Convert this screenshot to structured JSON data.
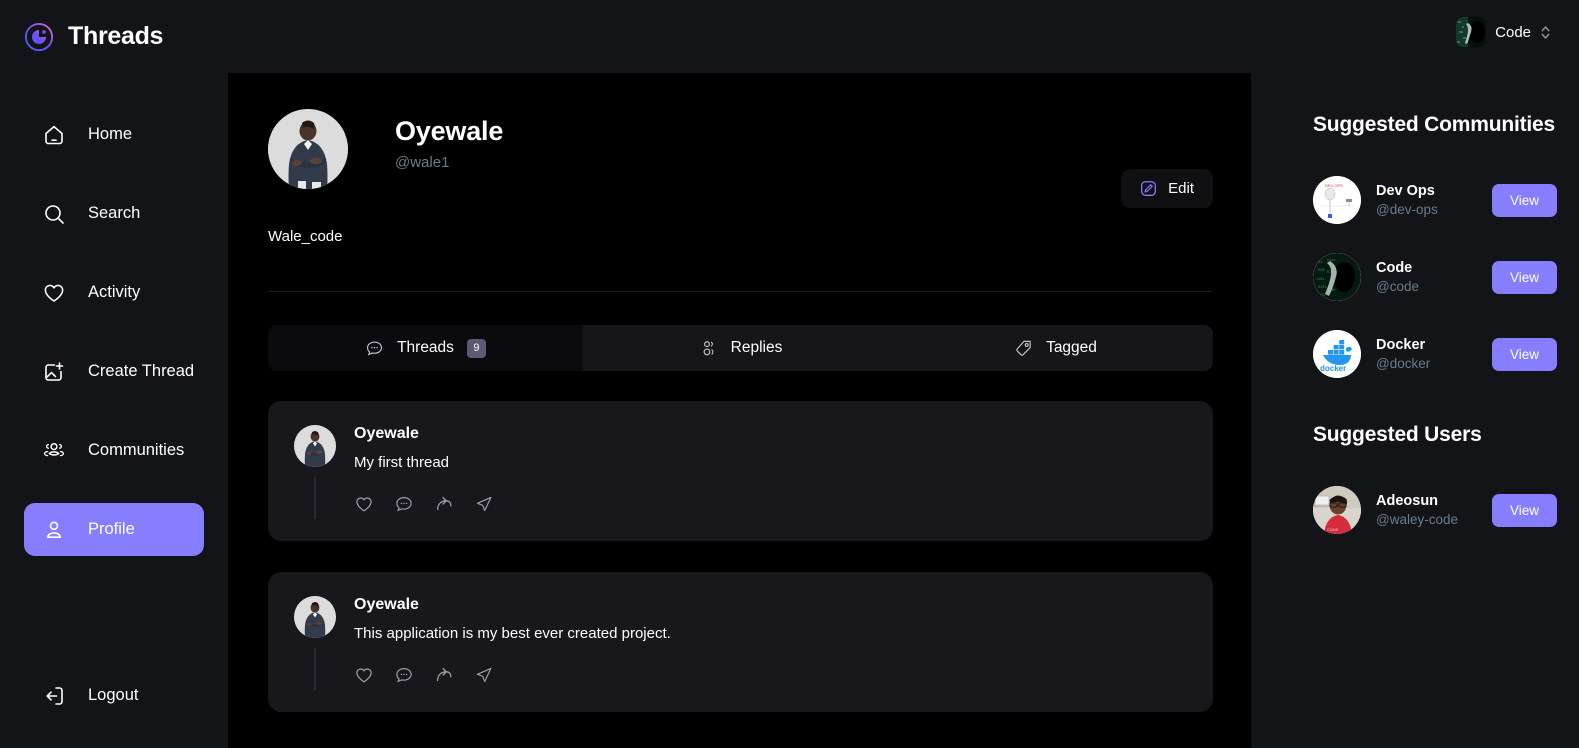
{
  "app": {
    "title": "Threads",
    "logo_icon": "threads-circle-logo"
  },
  "topbar": {
    "org_name": "Code",
    "org_chevrons_icon": "chevron-up-down-icon"
  },
  "sidebar": {
    "items": [
      {
        "label": "Home",
        "icon": "home-icon",
        "active": false
      },
      {
        "label": "Search",
        "icon": "search-icon",
        "active": false
      },
      {
        "label": "Activity",
        "icon": "heart-icon",
        "active": false
      },
      {
        "label": "Create Thread",
        "icon": "image-plus-icon",
        "active": false
      },
      {
        "label": "Communities",
        "icon": "users-icon",
        "active": false
      },
      {
        "label": "Profile",
        "icon": "user-icon",
        "active": true
      }
    ],
    "logout": {
      "label": "Logout",
      "icon": "logout-icon"
    },
    "active_color": "#877EFF"
  },
  "profile": {
    "name": "Oyewale",
    "handle": "@wale1",
    "bio": "Wale_code",
    "avatar_alt": "oyewale-avatar",
    "edit_button": {
      "label": "Edit",
      "icon": "edit-pencil-icon"
    }
  },
  "tabs": [
    {
      "label": "Threads",
      "icon": "reply-bubble-icon",
      "badge": "9",
      "active": true
    },
    {
      "label": "Replies",
      "icon": "members-icon",
      "badge": null,
      "active": false
    },
    {
      "label": "Tagged",
      "icon": "tag-icon",
      "badge": null,
      "active": false
    }
  ],
  "threads": [
    {
      "author": "Oyewale",
      "text": "My first thread",
      "actions": [
        "heart-icon",
        "reply-icon",
        "repost-icon",
        "share-icon"
      ]
    },
    {
      "author": "Oyewale",
      "text": "This application is my best ever created project.",
      "actions": [
        "heart-icon",
        "reply-icon",
        "repost-icon",
        "share-icon"
      ]
    }
  ],
  "right_panel": {
    "communities_title": "Suggested Communities",
    "users_title": "Suggested Users",
    "view_label": "View",
    "communities": [
      {
        "name": "Dev Ops",
        "handle": "@dev-ops",
        "avatar": "devops-avatar"
      },
      {
        "name": "Code",
        "handle": "@code",
        "avatar": "code-avatar"
      },
      {
        "name": "Docker",
        "handle": "@docker",
        "avatar": "docker-avatar"
      }
    ],
    "users": [
      {
        "name": "Adeosun",
        "handle": "@waley-code",
        "avatar": "adeosun-avatar"
      }
    ]
  },
  "colors": {
    "accent": "#877EFF",
    "page_bg": "#121417",
    "main_bg": "#000000",
    "card_bg": "#17171c",
    "muted_text": "#697c89"
  }
}
